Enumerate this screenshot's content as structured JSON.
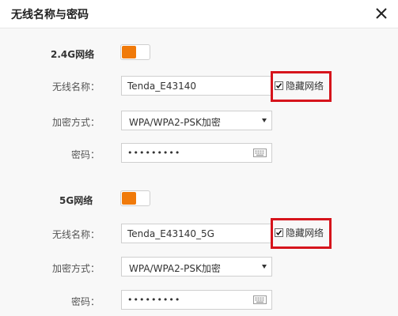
{
  "dialog": {
    "title": "无线名称与密码"
  },
  "colors": {
    "accent": "#f07a0a",
    "highlight": "#d6141c"
  },
  "band_24": {
    "title": "2.4G网络",
    "enabled": true,
    "ssid_label": "无线名称：",
    "ssid_value": "Tenda_E43140",
    "hide_label": "隐藏网络",
    "hide_checked": true,
    "encryption_label": "加密方式：",
    "encryption_value": "WPA/WPA2-PSK加密",
    "password_label": "密码：",
    "password_value": "•••••••••"
  },
  "band_5": {
    "title": "5G网络",
    "enabled": true,
    "ssid_label": "无线名称：",
    "ssid_value": "Tenda_E43140_5G",
    "hide_label": "隐藏网络",
    "hide_checked": true,
    "encryption_label": "加密方式：",
    "encryption_value": "WPA/WPA2-PSK加密",
    "password_label": "密码：",
    "password_value": "•••••••••"
  }
}
